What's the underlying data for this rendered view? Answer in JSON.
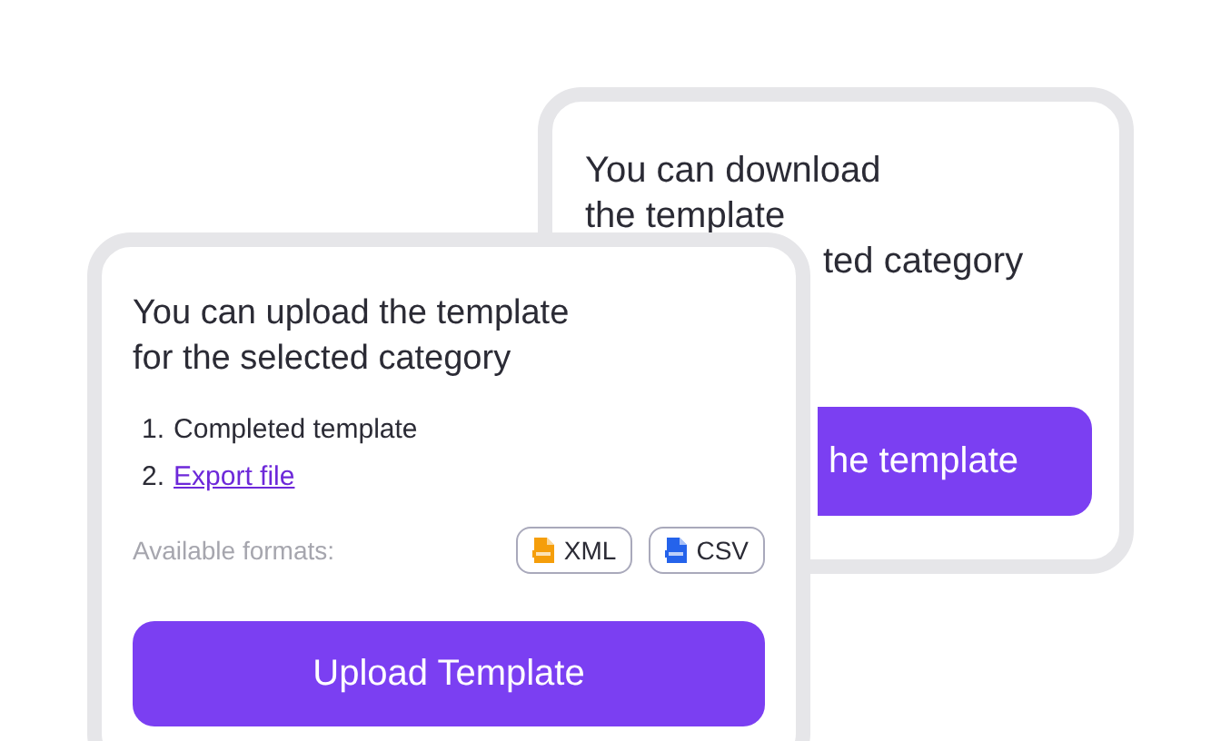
{
  "back_card": {
    "title_lines": [
      "You can download",
      "the template",
      "ted category"
    ],
    "button": "he template"
  },
  "front_card": {
    "title_lines": [
      "You can upload the template",
      "for the selected category"
    ],
    "steps": [
      {
        "number": "1.",
        "text": "Completed template",
        "kind": "text"
      },
      {
        "number": "2.",
        "text": "Export file",
        "kind": "link"
      }
    ],
    "formats_label": "Available formats:",
    "formats": [
      {
        "label": "XML",
        "color": "#f59e0b"
      },
      {
        "label": "CSV",
        "color": "#2563eb"
      }
    ],
    "button": "Upload Template"
  }
}
